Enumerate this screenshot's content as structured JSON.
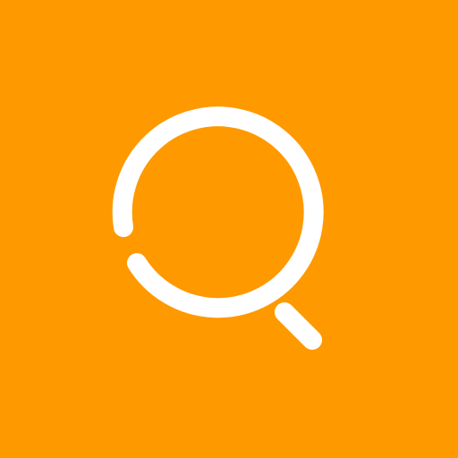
{
  "app_icon": {
    "icon_name": "search-icon",
    "background_color": "#ff9900",
    "glyph_color": "#ffffff"
  }
}
